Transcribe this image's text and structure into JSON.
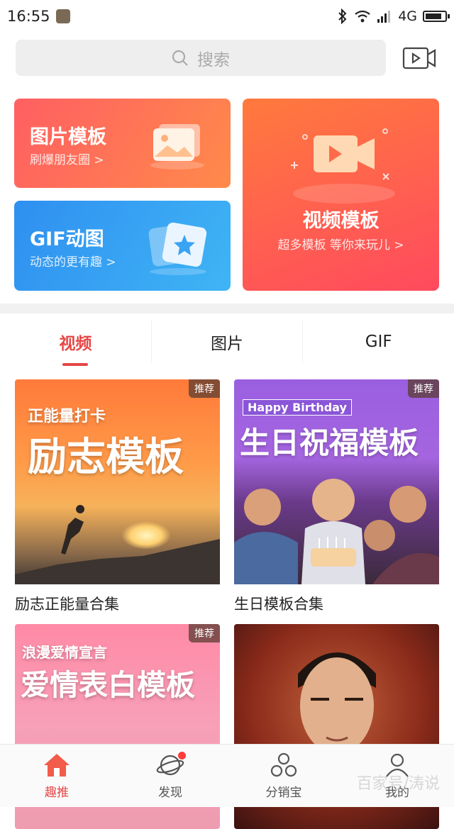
{
  "status_bar": {
    "time": "16:55",
    "network": "4G"
  },
  "search": {
    "placeholder": "搜索"
  },
  "cards": {
    "image_template": {
      "title": "图片模板",
      "subtitle": "刷爆朋友圈 >"
    },
    "gif": {
      "title": "GIF动图",
      "subtitle": "动态的更有趣 >"
    },
    "video_template": {
      "title": "视频模板",
      "subtitle": "超多模板 等你来玩儿 >"
    }
  },
  "tabs": [
    {
      "label": "视频",
      "active": true
    },
    {
      "label": "图片",
      "active": false
    },
    {
      "label": "GIF",
      "active": false
    }
  ],
  "templates": [
    {
      "badge": "推荐",
      "small_title": "正能量打卡",
      "big_title": "励志模板",
      "caption": "励志正能量合集"
    },
    {
      "badge": "推荐",
      "small_title": "Happy Birthday",
      "big_title": "生日祝福模板",
      "caption": "生日模板合集"
    },
    {
      "badge": "推荐",
      "small_title": "浪漫爱情宣言",
      "big_title": "爱情表白模板",
      "caption": ""
    },
    {
      "badge": "",
      "small_title": "",
      "big_title": "",
      "caption": ""
    }
  ],
  "bottom_nav": [
    {
      "label": "趣推",
      "icon": "home-icon",
      "active": true
    },
    {
      "label": "发现",
      "icon": "planet-icon",
      "active": false
    },
    {
      "label": "分销宝",
      "icon": "distribution-icon",
      "active": false
    },
    {
      "label": "我的",
      "icon": "profile-icon",
      "active": false
    }
  ],
  "watermark": "百家号/涛说",
  "colors": {
    "accent": "#e54646",
    "card_orange": "#ff6a55",
    "card_blue": "#3aa3f3"
  }
}
